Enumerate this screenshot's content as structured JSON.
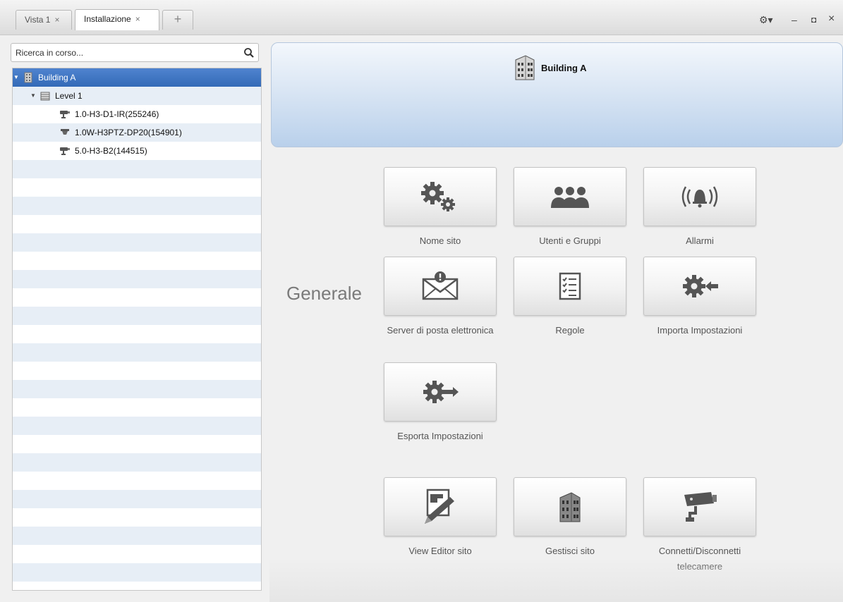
{
  "tabs": [
    {
      "label": "Vista 1"
    },
    {
      "label": "Installazione"
    }
  ],
  "tab_close_glyph": "×",
  "add_tab_glyph": "+",
  "window_controls": {
    "settings": "⚙▾",
    "minimize": "–",
    "maximize": "◘",
    "close": "×"
  },
  "search": {
    "placeholder": "Ricerca in corso...",
    "icon": "search-icon"
  },
  "tree": {
    "root": {
      "label": "Building A",
      "icon": "building-icon"
    },
    "level": {
      "label": "Level 1",
      "icon": "floor-icon"
    },
    "cameras": [
      {
        "label": "1.0-H3-D1-IR(255246)",
        "icon": "bullet-camera-icon"
      },
      {
        "label": "1.0W-H3PTZ-DP20(154901)",
        "icon": "ptz-camera-icon"
      },
      {
        "label": "5.0-H3-B2(144515)",
        "icon": "bullet-camera-icon"
      }
    ]
  },
  "header": {
    "title": "Building A",
    "icon": "building-icon"
  },
  "section": {
    "title": "Generale"
  },
  "tiles": [
    {
      "label": "Nome sito",
      "icon": "gears-icon"
    },
    {
      "label": "Utenti e Gruppi",
      "icon": "users-icon"
    },
    {
      "label": "Allarmi",
      "icon": "alarm-bell-icon"
    },
    {
      "label": "Server di posta elettronica",
      "icon": "mail-alert-icon"
    },
    {
      "label": "Regole",
      "icon": "checklist-icon"
    },
    {
      "label": "Importa Impostazioni",
      "icon": "gear-import-icon"
    },
    {
      "label": "Esporta Impostazioni",
      "icon": "gear-export-icon"
    },
    {
      "label": "View Editor sito",
      "icon": "map-edit-icon"
    },
    {
      "label": "Gestisci sito",
      "icon": "building-icon"
    },
    {
      "label": "Connetti/Disconnetti telecamere",
      "icon": "camera-icon"
    }
  ],
  "colors": {
    "selection": "#3f75c2",
    "header_gradient_bottom": "#b9d0eb",
    "tile_icon": "#555555"
  }
}
